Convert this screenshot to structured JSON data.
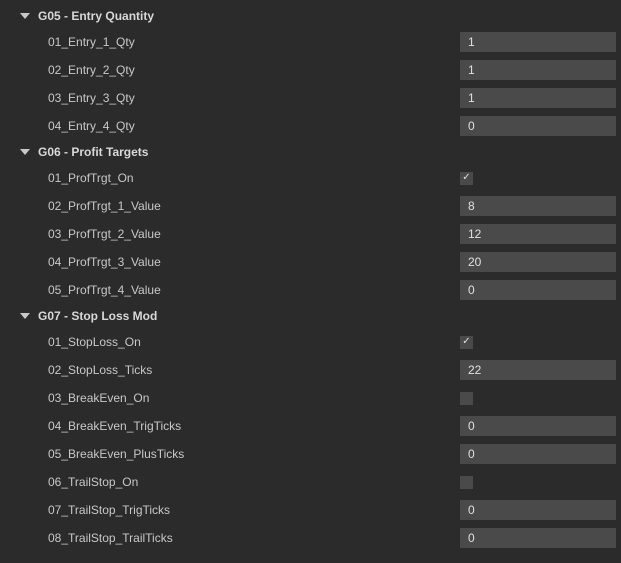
{
  "groups": [
    {
      "id": "g05",
      "title": "G05 - Entry Quantity",
      "items": [
        {
          "id": "entry1qty",
          "label": "01_Entry_1_Qty",
          "type": "number",
          "value": "1"
        },
        {
          "id": "entry2qty",
          "label": "02_Entry_2_Qty",
          "type": "number",
          "value": "1"
        },
        {
          "id": "entry3qty",
          "label": "03_Entry_3_Qty",
          "type": "number",
          "value": "1"
        },
        {
          "id": "entry4qty",
          "label": "04_Entry_4_Qty",
          "type": "number",
          "value": "0"
        }
      ]
    },
    {
      "id": "g06",
      "title": "G06 - Profit Targets",
      "items": [
        {
          "id": "proftrgt-on",
          "label": "01_ProfTrgt_On",
          "type": "checkbox",
          "checked": true
        },
        {
          "id": "proftrgt1val",
          "label": "02_ProfTrgt_1_Value",
          "type": "number",
          "value": "8"
        },
        {
          "id": "proftrgt2val",
          "label": "03_ProfTrgt_2_Value",
          "type": "number",
          "value": "12"
        },
        {
          "id": "proftrgt3val",
          "label": "04_ProfTrgt_3_Value",
          "type": "number",
          "value": "20"
        },
        {
          "id": "proftrgt4val",
          "label": "05_ProfTrgt_4_Value",
          "type": "number",
          "value": "0"
        }
      ]
    },
    {
      "id": "g07",
      "title": "G07 - Stop Loss Mod",
      "items": [
        {
          "id": "stoploss-on",
          "label": "01_StopLoss_On",
          "type": "checkbox",
          "checked": true
        },
        {
          "id": "stoploss-ticks",
          "label": "02_StopLoss_Ticks",
          "type": "number",
          "value": "22"
        },
        {
          "id": "breakeven-on",
          "label": "03_BreakEven_On",
          "type": "checkbox",
          "checked": false
        },
        {
          "id": "breakeven-trigticks",
          "label": "04_BreakEven_TrigTicks",
          "type": "number",
          "value": "0"
        },
        {
          "id": "breakeven-plusticks",
          "label": "05_BreakEven_PlusTicks",
          "type": "number",
          "value": "0"
        },
        {
          "id": "trailstop-on",
          "label": "06_TrailStop_On",
          "type": "checkbox",
          "checked": false
        },
        {
          "id": "trailstop-trigticks",
          "label": "07_TrailStop_TrigTicks",
          "type": "number",
          "value": "0"
        },
        {
          "id": "trailstop-trailticks",
          "label": "08_TrailStop_TrailTicks",
          "type": "number",
          "value": "0"
        }
      ]
    }
  ]
}
